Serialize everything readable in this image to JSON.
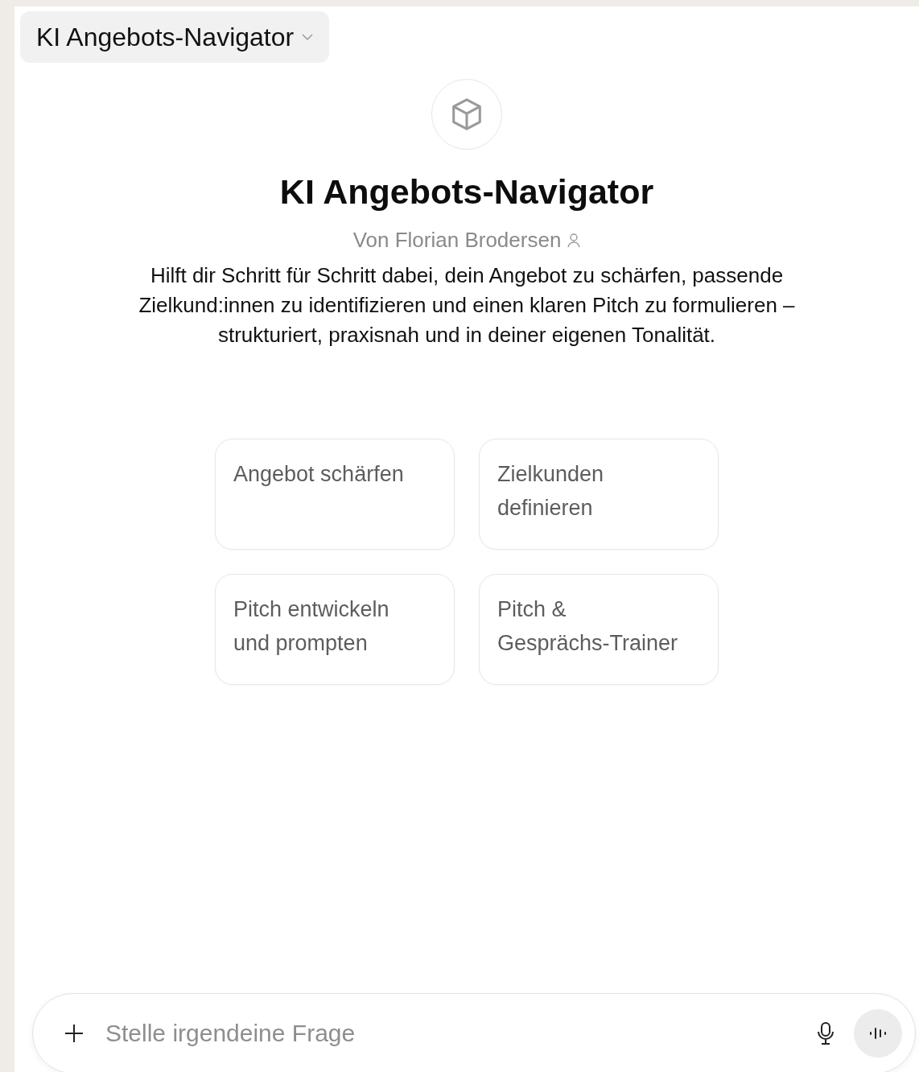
{
  "header": {
    "title": "KI Angebots-Navigator"
  },
  "profile": {
    "name": "KI Angebots-Navigator",
    "author": "Von Florian Brodersen",
    "description": "Hilft dir Schritt für Schritt dabei, dein Angebot zu schärfen, passende Zielkund:innen zu identifizieren und einen klaren Pitch zu formulieren – strukturiert, praxisnah und in deiner eigenen Tonalität."
  },
  "starters": [
    {
      "label": "Angebot schärfen"
    },
    {
      "label": "Zielkunden definieren"
    },
    {
      "label": "Pitch entwickeln und prompten"
    },
    {
      "label": "Pitch & Gesprächs-Trainer"
    }
  ],
  "composer": {
    "placeholder": "Stelle irgendeine Frage"
  }
}
